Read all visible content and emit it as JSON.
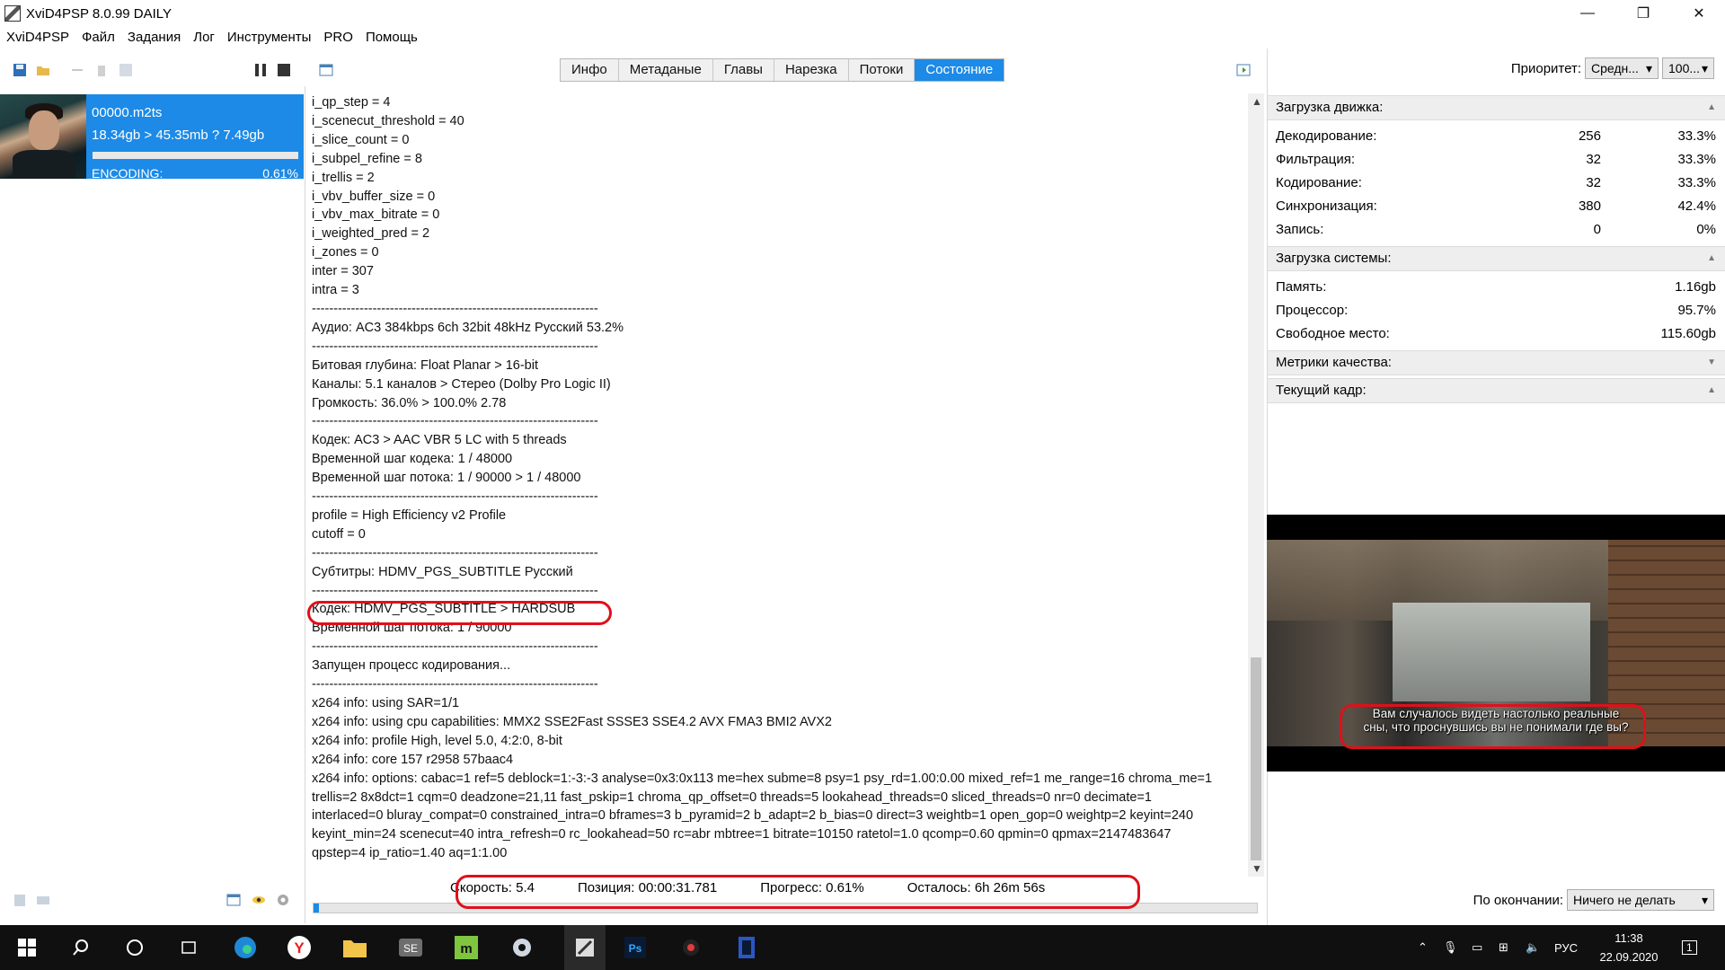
{
  "window": {
    "title": "XviD4PSP 8.0.99 DAILY",
    "minimize": "—",
    "maximize": "❐",
    "close": "✕"
  },
  "menu": [
    "XviD4PSP",
    "Файл",
    "Задания",
    "Лог",
    "Инструменты",
    "PRO",
    "Помощь"
  ],
  "task": {
    "name": "00000.m2ts",
    "sizes": "18.34gb > 45.35mb ? 7.49gb",
    "status": "ENCODING:",
    "percent": "0.61%",
    "progress_fraction": 0.0061
  },
  "tabs": [
    {
      "label": "Инфо",
      "active": false
    },
    {
      "label": "Метаданые",
      "active": false
    },
    {
      "label": "Главы",
      "active": false
    },
    {
      "label": "Нарезка",
      "active": false
    },
    {
      "label": "Потоки",
      "active": false
    },
    {
      "label": "Состояние",
      "active": true
    }
  ],
  "log": [
    "i_qp_step = 4",
    "i_scenecut_threshold = 40",
    "i_slice_count = 0",
    "i_subpel_refine = 8",
    "i_trellis = 2",
    "i_vbv_buffer_size = 0",
    "i_vbv_max_bitrate = 0",
    "i_weighted_pred = 2",
    "i_zones = 0",
    "inter = 307",
    "intra = 3",
    "------------------------------------------------------------------",
    "Аудио: AC3 384kbps 6ch 32bit 48kHz Русский 53.2%",
    "------------------------------------------------------------------",
    "Битовая глубина: Float Planar > 16-bit",
    "Каналы: 5.1 каналов > Стерео (Dolby Pro Logic II)",
    "Громкость: 36.0% > 100.0% 2.78",
    "------------------------------------------------------------------",
    "Кодек: AC3 > AAC VBR 5 LC with 5 threads",
    "Временной шаг кодека: 1 / 48000",
    "Временной шаг потока: 1 / 90000 > 1 / 48000",
    "------------------------------------------------------------------",
    "profile = High Efficiency v2 Profile",
    "cutoff = 0",
    "------------------------------------------------------------------",
    "Субтитры: HDMV_PGS_SUBTITLE Русский",
    "------------------------------------------------------------------",
    "Кодек: HDMV_PGS_SUBTITLE > HARDSUB",
    "Временной шаг потока: 1 / 90000",
    "------------------------------------------------------------------",
    "Запущен процесс кодирования...",
    "------------------------------------------------------------------",
    "x264 info: using SAR=1/1",
    "x264 info: using cpu capabilities: MMX2 SSE2Fast SSSE3 SSE4.2 AVX FMA3 BMI2 AVX2",
    "x264 info: profile High, level 5.0, 4:2:0, 8-bit",
    "x264 info: core 157 r2958 57baac4",
    "x264 info: options: cabac=1 ref=5 deblock=1:-3:-3 analyse=0x3:0x113 me=hex subme=8 psy=1 psy_rd=1.00:0.00 mixed_ref=1 me_range=16 chroma_me=1",
    "trellis=2 8x8dct=1 cqm=0 deadzone=21,11 fast_pskip=1 chroma_qp_offset=0 threads=5 lookahead_threads=0 sliced_threads=0 nr=0 decimate=1",
    "interlaced=0 bluray_compat=0 constrained_intra=0 bframes=3 b_pyramid=2 b_adapt=2 b_bias=0 direct=3 weightb=1 open_gop=0 weightp=2 keyint=240",
    "keyint_min=24 scenecut=40 intra_refresh=0 rc_lookahead=50 rc=abr mbtree=1 bitrate=10150 ratetol=1.0 qcomp=0.60 qpmin=0 qpmax=2147483647",
    "qpstep=4 ip_ratio=1.40 aq=1:1.00"
  ],
  "status": {
    "speed": "Скорость: 5.4",
    "position": "Позиция: 00:00:31.781",
    "progress": "Прогресс: 0.61%",
    "remaining": "Осталось: 6h 26m 56s",
    "progress_fraction": 0.0061
  },
  "right": {
    "priority_label": "Приоритет:",
    "priority_value": "Средн...",
    "priority_pct": "100...",
    "engine_header": "Загрузка движка:",
    "engine_rows": [
      {
        "name": "Декодирование:",
        "count": "256",
        "pct": "33.3%"
      },
      {
        "name": "Фильтрация:",
        "count": "32",
        "pct": "33.3%"
      },
      {
        "name": "Кодирование:",
        "count": "32",
        "pct": "33.3%"
      },
      {
        "name": "Синхронизация:",
        "count": "380",
        "pct": "42.4%"
      },
      {
        "name": "Запись:",
        "count": "0",
        "pct": "0%"
      }
    ],
    "system_header": "Загрузка системы:",
    "system_rows": [
      {
        "name": "Память:",
        "value": "1.16gb"
      },
      {
        "name": "Процессор:",
        "value": "95.7%"
      },
      {
        "name": "Свободное место:",
        "value": "115.60gb"
      }
    ],
    "quality_header": "Метрики качества:",
    "frame_header": "Текущий кадр:",
    "subtitle_line1": "Вам случалось видеть настолько реальные",
    "subtitle_line2": "сны, что проснувшись вы не понимали где вы?",
    "onfinish_label": "По окончании:",
    "onfinish_value": "Ничего не делать"
  },
  "taskbar": {
    "lang": "РУС",
    "time": "11:38",
    "date": "22.09.2020",
    "notifications": "1"
  },
  "colors": {
    "accent": "#1c8ae6",
    "highlight": "#e0101a"
  }
}
